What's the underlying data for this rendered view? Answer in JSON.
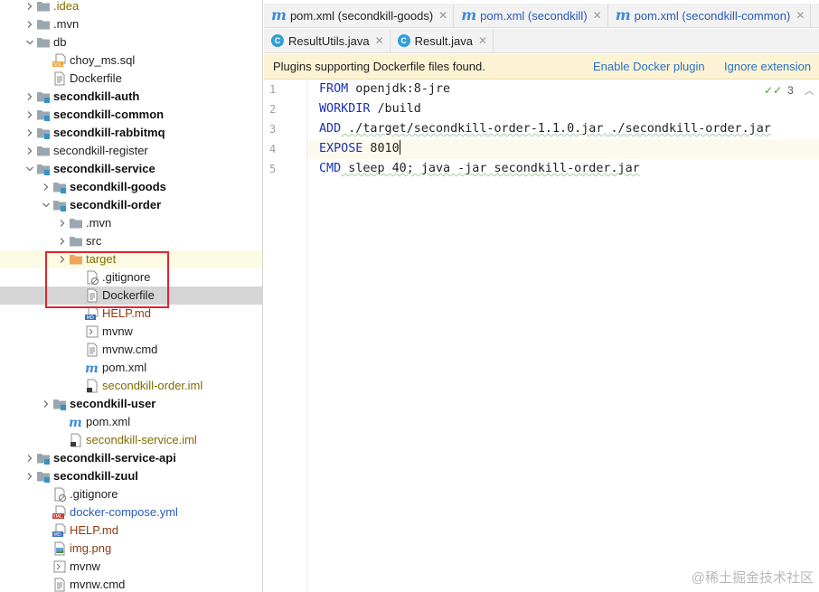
{
  "tree": {
    "items": [
      {
        "label": ".idea",
        "depth": 1,
        "expand": "collapsed",
        "icon": "folder-icon",
        "style": "olive"
      },
      {
        "label": ".mvn",
        "depth": 1,
        "expand": "collapsed",
        "icon": "folder-icon",
        "style": "plain"
      },
      {
        "label": "db",
        "depth": 1,
        "expand": "expanded",
        "icon": "folder-icon",
        "style": "plain"
      },
      {
        "label": "choy_ms.sql",
        "depth": 2,
        "expand": "none",
        "icon": "sql-file-icon",
        "style": "plain"
      },
      {
        "label": "Dockerfile",
        "depth": 2,
        "expand": "none",
        "icon": "text-file-icon",
        "style": "plain"
      },
      {
        "label": "secondkill-auth",
        "depth": 1,
        "expand": "collapsed",
        "icon": "module-folder-icon",
        "style": "bold"
      },
      {
        "label": "secondkill-common",
        "depth": 1,
        "expand": "collapsed",
        "icon": "module-folder-icon",
        "style": "bold"
      },
      {
        "label": "secondkill-rabbitmq",
        "depth": 1,
        "expand": "collapsed",
        "icon": "module-folder-icon",
        "style": "bold"
      },
      {
        "label": "secondkill-register",
        "depth": 1,
        "expand": "collapsed",
        "icon": "folder-icon",
        "style": "plain"
      },
      {
        "label": "secondkill-service",
        "depth": 1,
        "expand": "expanded",
        "icon": "module-folder-icon",
        "style": "bold"
      },
      {
        "label": "secondkill-goods",
        "depth": 2,
        "expand": "collapsed",
        "icon": "module-folder-icon",
        "style": "bold"
      },
      {
        "label": "secondkill-order",
        "depth": 2,
        "expand": "expanded",
        "icon": "module-folder-icon",
        "style": "bold"
      },
      {
        "label": ".mvn",
        "depth": 3,
        "expand": "collapsed",
        "icon": "folder-icon",
        "style": "plain"
      },
      {
        "label": "src",
        "depth": 3,
        "expand": "collapsed",
        "icon": "folder-icon",
        "style": "plain"
      },
      {
        "label": "target",
        "depth": 3,
        "expand": "collapsed",
        "icon": "excluded-folder-icon",
        "style": "olive",
        "highlight": "yellow"
      },
      {
        "label": ".gitignore",
        "depth": 4,
        "expand": "none",
        "icon": "gitignore-file-icon",
        "style": "plain"
      },
      {
        "label": "Dockerfile",
        "depth": 4,
        "expand": "none",
        "icon": "text-file-icon",
        "style": "plain",
        "highlight": "gray"
      },
      {
        "label": "HELP.md",
        "depth": 4,
        "expand": "none",
        "icon": "markdown-file-icon",
        "style": "red"
      },
      {
        "label": "mvnw",
        "depth": 4,
        "expand": "none",
        "icon": "script-file-icon",
        "style": "plain"
      },
      {
        "label": "mvnw.cmd",
        "depth": 4,
        "expand": "none",
        "icon": "text-file-icon",
        "style": "plain"
      },
      {
        "label": "pom.xml",
        "depth": 4,
        "expand": "none",
        "icon": "maven-icon",
        "style": "plain"
      },
      {
        "label": "secondkill-order.iml",
        "depth": 4,
        "expand": "none",
        "icon": "iml-file-icon",
        "style": "olive"
      },
      {
        "label": "secondkill-user",
        "depth": 2,
        "expand": "collapsed",
        "icon": "module-folder-icon",
        "style": "bold"
      },
      {
        "label": "pom.xml",
        "depth": 3,
        "expand": "none",
        "icon": "maven-icon",
        "style": "plain"
      },
      {
        "label": "secondkill-service.iml",
        "depth": 3,
        "expand": "none",
        "icon": "iml-file-icon",
        "style": "olive"
      },
      {
        "label": "secondkill-service-api",
        "depth": 1,
        "expand": "collapsed",
        "icon": "module-folder-icon",
        "style": "bold"
      },
      {
        "label": "secondkill-zuul",
        "depth": 1,
        "expand": "collapsed",
        "icon": "module-folder-icon",
        "style": "bold"
      },
      {
        "label": ".gitignore",
        "depth": 2,
        "expand": "none",
        "icon": "gitignore-file-icon",
        "style": "plain"
      },
      {
        "label": "docker-compose.yml",
        "depth": 2,
        "expand": "none",
        "icon": "yml-file-icon",
        "style": "blue"
      },
      {
        "label": "HELP.md",
        "depth": 2,
        "expand": "none",
        "icon": "markdown-file-icon",
        "style": "red"
      },
      {
        "label": "img.png",
        "depth": 2,
        "expand": "none",
        "icon": "image-file-icon",
        "style": "red"
      },
      {
        "label": "mvnw",
        "depth": 2,
        "expand": "none",
        "icon": "script-file-icon",
        "style": "plain"
      },
      {
        "label": "mvnw.cmd",
        "depth": 2,
        "expand": "none",
        "icon": "text-file-icon",
        "style": "plain"
      }
    ]
  },
  "tabs_row1": [
    {
      "label": "pom.xml (secondkill-goods)",
      "icon": "maven-icon",
      "active": false,
      "blue": false
    },
    {
      "label": "pom.xml (secondkill)",
      "icon": "maven-icon",
      "active": false,
      "blue": true
    },
    {
      "label": "pom.xml (secondkill-common)",
      "icon": "maven-icon",
      "active": false,
      "blue": true
    }
  ],
  "tabs_row2": [
    {
      "label": "ResultUtils.java",
      "icon": "java-class-icon",
      "active": false
    },
    {
      "label": "Result.java",
      "icon": "java-class-icon",
      "active": false
    }
  ],
  "banner": {
    "message": "Plugins supporting Dockerfile files found.",
    "enable_label": "Enable Docker plugin",
    "ignore_label": "Ignore extension"
  },
  "inspection": {
    "count": "3"
  },
  "code": [
    {
      "num": "1",
      "kw": "FROM",
      "rest": " openjdk:8-jre"
    },
    {
      "num": "2",
      "kw": "WORKDIR",
      "rest": " /build"
    },
    {
      "num": "3",
      "kw": "ADD",
      "rest": " ./target/secondkill-order-1.1.0.jar ./secondkill-order.jar"
    },
    {
      "num": "4",
      "kw": "EXPOSE",
      "rest": " 8010"
    },
    {
      "num": "5",
      "kw": "CMD",
      "rest": " sleep 40; java -jar secondkill-order.jar"
    }
  ],
  "watermark": "@稀土掘金技术社区",
  "colors": {
    "accent": "#2b73c8",
    "keyword": "#1a32b7",
    "selection_box": "#e0252e"
  }
}
